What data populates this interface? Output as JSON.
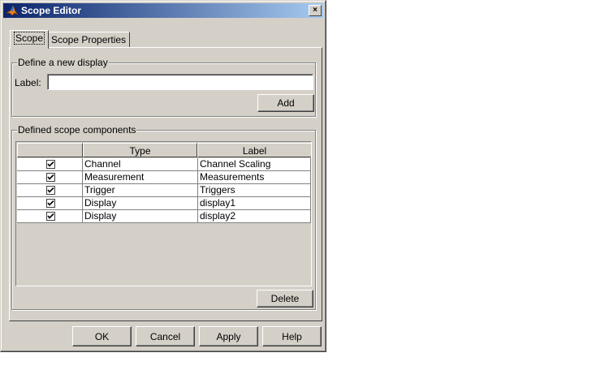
{
  "window": {
    "title": "Scope Editor",
    "close_symbol": "×"
  },
  "tabs": [
    {
      "label": "Scope",
      "active": true
    },
    {
      "label": "Scope Properties",
      "active": false
    }
  ],
  "define_group": {
    "legend": "Define a new display",
    "label_caption": "Label:",
    "label_value": "",
    "add_button": "Add"
  },
  "components_group": {
    "legend": "Defined scope components",
    "columns": [
      "",
      "Type",
      "Label"
    ],
    "rows": [
      {
        "checked": true,
        "type": "Channel",
        "label": "Channel Scaling"
      },
      {
        "checked": true,
        "type": "Measurement",
        "label": "Measurements"
      },
      {
        "checked": true,
        "type": "Trigger",
        "label": "Triggers"
      },
      {
        "checked": true,
        "type": "Display",
        "label": "display1"
      },
      {
        "checked": true,
        "type": "Display",
        "label": "display2"
      }
    ],
    "delete_button": "Delete"
  },
  "footer": {
    "ok": "OK",
    "cancel": "Cancel",
    "apply": "Apply",
    "help": "Help"
  },
  "colors": {
    "titlebar_start": "#0a246a",
    "titlebar_end": "#a6caf0",
    "face": "#d4d0c8"
  }
}
